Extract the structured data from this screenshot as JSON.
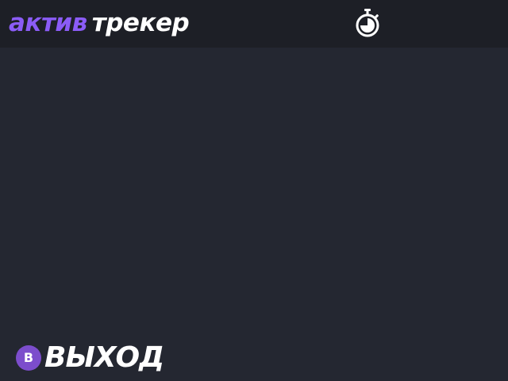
{
  "header": {
    "logo_part_1": "актив",
    "logo_part_2": "трекер",
    "timer_icon": "stopwatch-icon"
  },
  "footer": {
    "exit_key": "B",
    "exit_label": "ВЫХОД"
  },
  "colors": {
    "accent": "#8b5cf6",
    "header_bg": "#1d1f26",
    "page_bg": "#242731",
    "key_badge": "#7c4dcc",
    "text": "#ffffff"
  }
}
